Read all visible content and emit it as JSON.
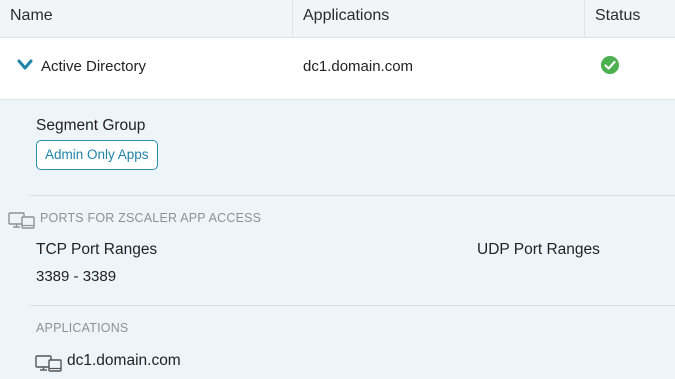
{
  "table": {
    "headers": {
      "name": "Name",
      "applications": "Applications",
      "status": "Status"
    },
    "row": {
      "name": "Active Directory",
      "application": "dc1.domain.com",
      "status_icon": "check-circle-icon",
      "status_color": "#4caf50",
      "expanded": true
    }
  },
  "detail": {
    "segment_group_label": "Segment Group",
    "segment_group_value": "Admin Only Apps",
    "ports_section_title": "PORTS FOR ZSCALER APP ACCESS",
    "tcp_label": "TCP Port Ranges",
    "udp_label": "UDP Port Ranges",
    "tcp_ranges": [
      "3389 - 3389"
    ],
    "applications_title": "APPLICATIONS",
    "applications": [
      "dc1.domain.com"
    ]
  },
  "colors": {
    "accent": "#1f84a8",
    "detail_bg": "#eef5fa",
    "header_bg": "#f3f4f5"
  }
}
